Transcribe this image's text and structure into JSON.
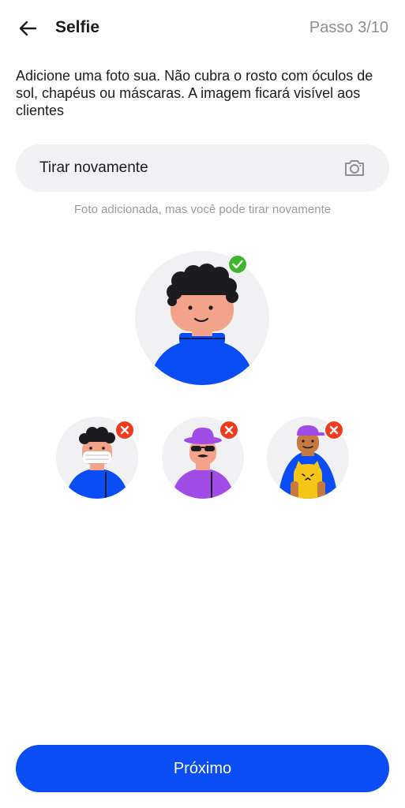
{
  "header": {
    "back_icon": "arrow-left-icon",
    "title": "Selfie",
    "step": "Passo 3/10"
  },
  "instructions": "Adicione uma foto sua. Não cubra o rosto com óculos de sol, chapéus ou máscaras. A imagem ficará visível aos clientes",
  "retake": {
    "label": "Tirar novamente",
    "icon": "camera-icon"
  },
  "hint": "Foto adicionada, mas você pode tirar novamente",
  "examples": {
    "good": {
      "status": "check",
      "icon": "check-badge-icon"
    },
    "bad": [
      {
        "item": "mask",
        "icon": "x-badge-icon"
      },
      {
        "item": "hat-sunglasses",
        "icon": "x-badge-icon"
      },
      {
        "item": "cap-and-pet",
        "icon": "x-badge-icon"
      }
    ]
  },
  "footer": {
    "next_label": "Próximo"
  },
  "colors": {
    "primary": "#0a4df5",
    "success": "#3fb52b",
    "error": "#ee3b1e",
    "purple": "#a24ce8",
    "muted": "#8e8e93"
  }
}
